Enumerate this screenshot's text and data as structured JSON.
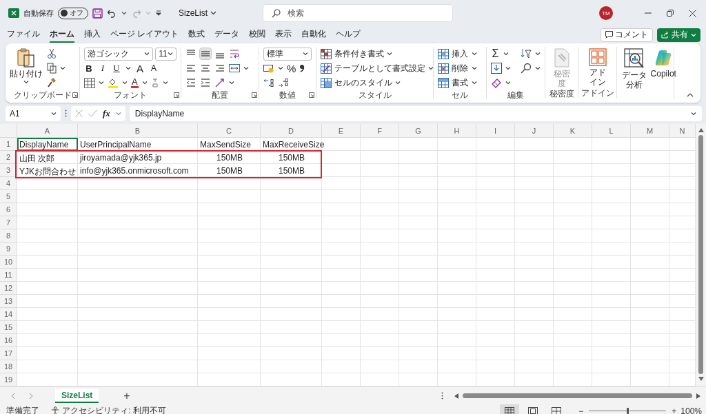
{
  "title_bar": {
    "autosave_label": "自動保存",
    "autosave": {
      "label": "オフ",
      "on": false
    },
    "file_name": "SizeList",
    "search_placeholder": "検索",
    "avatar": "TM"
  },
  "ribbon_tabs": [
    {
      "label": "ファイル",
      "selected": false
    },
    {
      "label": "ホーム",
      "selected": true
    },
    {
      "label": "挿入",
      "selected": false
    },
    {
      "label": "ページ レイアウト",
      "selected": false
    },
    {
      "label": "数式",
      "selected": false
    },
    {
      "label": "データ",
      "selected": false
    },
    {
      "label": "校閲",
      "selected": false
    },
    {
      "label": "表示",
      "selected": false
    },
    {
      "label": "自動化",
      "selected": false
    },
    {
      "label": "ヘルプ",
      "selected": false
    }
  ],
  "comment_button": "コメント",
  "share_button": "共有",
  "ribbon": {
    "clipboard": {
      "label": "クリップボード",
      "paste": "貼り付け"
    },
    "font": {
      "label": "フォント",
      "font_name": "游ゴシック",
      "font_size": "11",
      "format_buttons": [
        {
          "kind": "bold",
          "label": "B"
        },
        {
          "kind": "italic",
          "label": "I"
        },
        {
          "kind": "underline",
          "label": "U"
        },
        {
          "kind": "grow",
          "label": "A"
        },
        {
          "kind": "shrink",
          "label": "A"
        }
      ],
      "font_color": "A"
    },
    "alignment": {
      "label": "配置"
    },
    "number": {
      "label": "数値",
      "format": "標準",
      "percent": "%"
    },
    "styles": {
      "label": "スタイル",
      "items": [
        {
          "kind": "conditional",
          "label": "条件付き書式"
        },
        {
          "kind": "table",
          "label": "テーブルとして書式設定"
        },
        {
          "kind": "cell_styles",
          "label": "セルのスタイル"
        }
      ]
    },
    "cells": {
      "label": "セル",
      "items": [
        {
          "kind": "insert",
          "label": "挿入"
        },
        {
          "kind": "delete",
          "label": "削除"
        },
        {
          "kind": "format",
          "label": "書式"
        }
      ]
    },
    "editing": {
      "label": "編集",
      "sum": "Σ"
    },
    "sensitivity": {
      "label": "秘密度",
      "button": "秘密度",
      "disabled": true
    },
    "addins": {
      "label": "アドイン",
      "button": "アドイン"
    },
    "analysis": [
      {
        "kind": "data_analysis",
        "label": "データ分析"
      },
      {
        "kind": "copilot",
        "label": "Copilot"
      }
    ]
  },
  "formula_bar": {
    "name_box": "A1",
    "fx": "fx",
    "formula": "DisplayName"
  },
  "sheet": {
    "columns": [
      "A",
      "B",
      "C",
      "D",
      "E",
      "F",
      "G",
      "H",
      "I",
      "J",
      "K",
      "L",
      "M",
      "N"
    ],
    "rows": [
      {
        "header": "1",
        "cells": [
          {
            "text": "DisplayName"
          },
          {
            "text": "UserPrincipalName"
          },
          {
            "text": "MaxSendSize"
          },
          {
            "text": "MaxReceiveSize"
          }
        ]
      },
      {
        "header": "2",
        "cells": [
          {
            "text": "山田 次郎"
          },
          {
            "text": "jiroyamada@yjk365.jp"
          },
          {
            "text": "150MB",
            "kind": "size"
          },
          {
            "text": "150MB",
            "kind": "size"
          }
        ]
      },
      {
        "header": "3",
        "cells": [
          {
            "text": "YJKお問合わせ"
          },
          {
            "text": "info@yjk365.onmicrosoft.com"
          },
          {
            "text": "150MB",
            "kind": "size"
          },
          {
            "text": "150MB",
            "kind": "size"
          }
        ]
      },
      {
        "header": "4"
      },
      {
        "header": "5"
      },
      {
        "header": "6"
      },
      {
        "header": "7"
      },
      {
        "header": "8"
      },
      {
        "header": "9"
      },
      {
        "header": "10"
      },
      {
        "header": "11"
      },
      {
        "header": "12"
      },
      {
        "header": "13"
      },
      {
        "header": "14"
      },
      {
        "header": "15"
      },
      {
        "header": "16"
      },
      {
        "header": "17"
      },
      {
        "header": "18"
      },
      {
        "header": "19"
      }
    ]
  },
  "sheet_tabs": {
    "tabs": [
      {
        "label": "SizeList",
        "selected": true
      }
    ],
    "add": "+"
  },
  "status_bar": {
    "status": "準備完了",
    "accessibility": "アクセシビリティ: 利用不可",
    "views": [
      {
        "kind": "normal",
        "selected": true
      },
      {
        "kind": "page_layout",
        "selected": false
      },
      {
        "kind": "page_break",
        "selected": false
      }
    ],
    "zoom_out": "−",
    "zoom_in": "+",
    "zoom": {
      "level": 0.5
    },
    "zoom_label": "100%"
  }
}
